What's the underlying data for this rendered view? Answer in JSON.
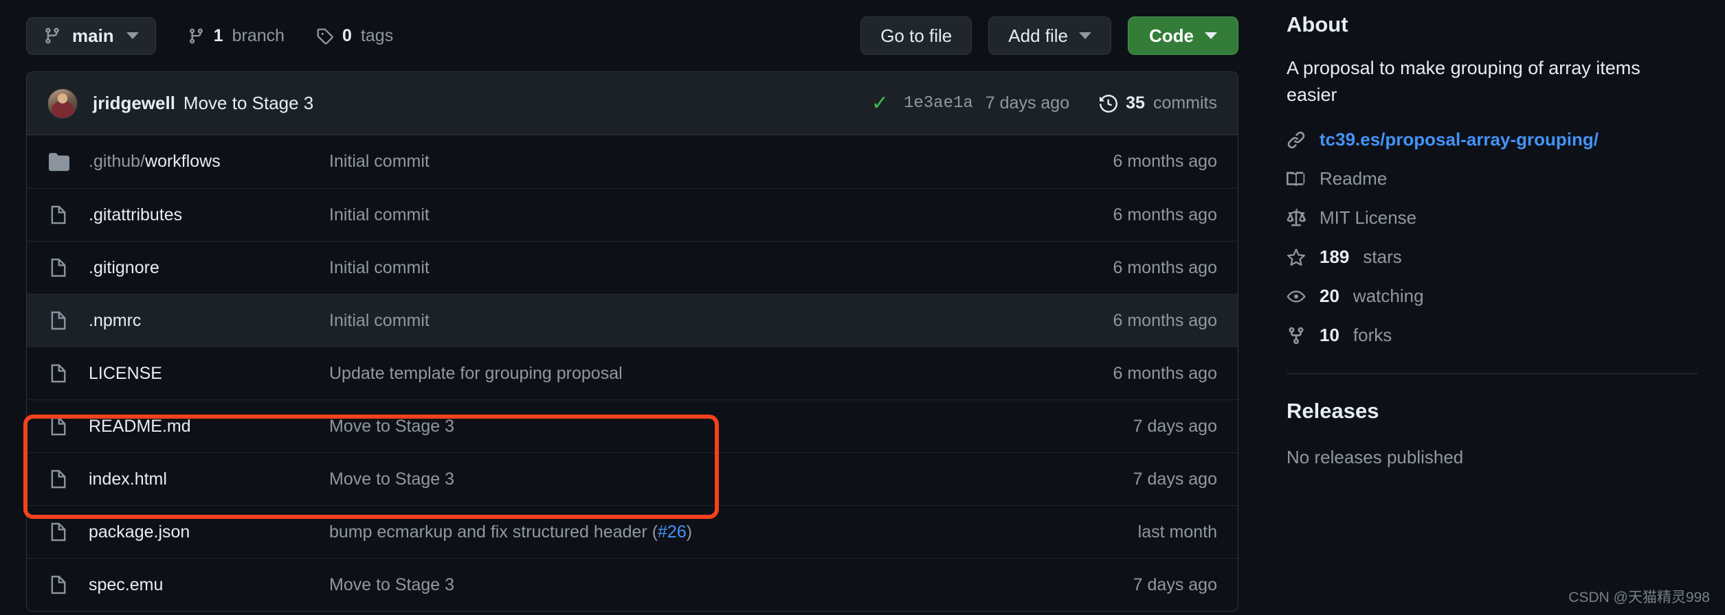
{
  "toolbar": {
    "branch_name": "main",
    "branch_icon": "git-branch-icon",
    "branch_count": "1",
    "branch_count_label": "branch",
    "tag_count": "0",
    "tag_count_label": "tags",
    "go_to_file": "Go to file",
    "add_file": "Add file",
    "code": "Code"
  },
  "commit_bar": {
    "author": "jridgewell",
    "message": "Move to Stage 3",
    "status_icon": "check-icon",
    "sha": "1e3ae1a",
    "date": "7 days ago",
    "commits_count": "35",
    "commits_label": "commits"
  },
  "file_table": {
    "rows": [
      {
        "icon": "folder-icon",
        "name_dim": ".github/",
        "name": "workflows",
        "message": "Initial commit",
        "date": "6 months ago",
        "hover": false,
        "highlighted": false
      },
      {
        "icon": "file-icon",
        "name_dim": "",
        "name": ".gitattributes",
        "message": "Initial commit",
        "date": "6 months ago",
        "hover": false,
        "highlighted": false
      },
      {
        "icon": "file-icon",
        "name_dim": "",
        "name": ".gitignore",
        "message": "Initial commit",
        "date": "6 months ago",
        "hover": false,
        "highlighted": false
      },
      {
        "icon": "file-icon",
        "name_dim": "",
        "name": ".npmrc",
        "message": "Initial commit",
        "date": "6 months ago",
        "hover": true,
        "highlighted": false
      },
      {
        "icon": "file-icon",
        "name_dim": "",
        "name": "LICENSE",
        "message": "Update template for grouping proposal",
        "date": "6 months ago",
        "hover": false,
        "highlighted": false
      },
      {
        "icon": "file-icon",
        "name_dim": "",
        "name": "README.md",
        "message": "Move to Stage 3",
        "date": "7 days ago",
        "hover": false,
        "highlighted": true
      },
      {
        "icon": "file-icon",
        "name_dim": "",
        "name": "index.html",
        "message": "Move to Stage 3",
        "date": "7 days ago",
        "hover": false,
        "highlighted": true
      },
      {
        "icon": "file-icon",
        "name_dim": "",
        "name": "package.json",
        "message": "bump ecmarkup and fix structured header (",
        "message_link": "#26",
        "message_tail": ")",
        "date": "last month",
        "hover": false,
        "highlighted": false
      },
      {
        "icon": "file-icon",
        "name_dim": "",
        "name": "spec.emu",
        "message": "Move to Stage 3",
        "date": "7 days ago",
        "hover": false,
        "highlighted": false
      }
    ]
  },
  "sidebar": {
    "about_title": "About",
    "description": "A proposal to make grouping of array items easier",
    "homepage": "tc39.es/proposal-array-grouping/",
    "homepage_icon": "link-icon",
    "items": [
      {
        "icon": "book-icon",
        "num": "",
        "label": "Readme"
      },
      {
        "icon": "law-icon",
        "num": "",
        "label": "MIT License"
      },
      {
        "icon": "star-icon",
        "num": "189",
        "label": "stars"
      },
      {
        "icon": "eye-icon",
        "num": "20",
        "label": "watching"
      },
      {
        "icon": "fork-icon",
        "num": "10",
        "label": "forks"
      }
    ],
    "releases_title": "Releases",
    "releases_empty": "No releases published"
  },
  "annotation": {
    "color": "#f4411e",
    "covers": "README.md and index.html rows"
  },
  "watermark": "CSDN @天猫精灵998"
}
